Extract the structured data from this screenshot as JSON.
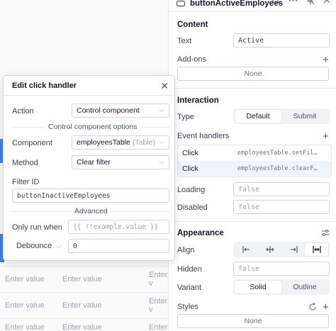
{
  "background_table": {
    "placeholder": "Enter value",
    "rows": [
      {
        "cells": [
          "Enter value",
          "Enter value",
          "Enter v"
        ]
      },
      {
        "cells": [
          "Enter value",
          "Enter value",
          "Enter v"
        ]
      },
      {
        "cells": [
          "Enter value",
          "Enter value",
          "Enter v"
        ]
      }
    ]
  },
  "inspector": {
    "component_name": "buttonActiveEmployees",
    "content": {
      "title": "Content",
      "text_label": "Text",
      "text_value": "Active",
      "addons_label": "Add-ons",
      "addons_value": "None"
    },
    "interaction": {
      "title": "Interaction",
      "type_label": "Type",
      "type_options": [
        "Default",
        "Submit"
      ],
      "type_selected": "Default",
      "event_handlers_label": "Event handlers",
      "handlers": [
        {
          "event": "Click",
          "code": "employeesTable.setFil…"
        },
        {
          "event": "Click",
          "code": "employeesTable.clearF…"
        }
      ],
      "loading_label": "Loading",
      "loading_value": "false",
      "disabled_label": "Disabled",
      "disabled_value": "false"
    },
    "appearance": {
      "title": "Appearance",
      "align_label": "Align",
      "align_options": [
        "align-left",
        "align-center",
        "align-right",
        "align-stretch"
      ],
      "align_selected": "align-stretch",
      "hidden_label": "Hidden",
      "hidden_value": "false",
      "variant_label": "Variant",
      "variant_options": [
        "Solid",
        "Outline"
      ],
      "variant_selected": "Solid",
      "styles_label": "Styles",
      "styles_value": "None"
    }
  },
  "modal": {
    "title": "Edit click handler",
    "action_label": "Action",
    "action_value": "Control component",
    "group_title": "Control component options",
    "component_label": "Component",
    "component_value": "employeesTable",
    "component_type": "(Table)",
    "method_label": "Method",
    "method_value": "Clear filter",
    "filter_id_label": "Filter ID",
    "filter_id_value": "buttonInactiveEmployees",
    "advanced_title": "Advanced",
    "only_run_when_label": "Only run when",
    "only_run_when_placeholder": "{{ !!example.value }}",
    "debounce_label": "Debounce",
    "debounce_value": "0"
  },
  "colors": {
    "accent": "#3b82f6",
    "border": "#d1d5db",
    "selected_row": "#eef4fb"
  }
}
